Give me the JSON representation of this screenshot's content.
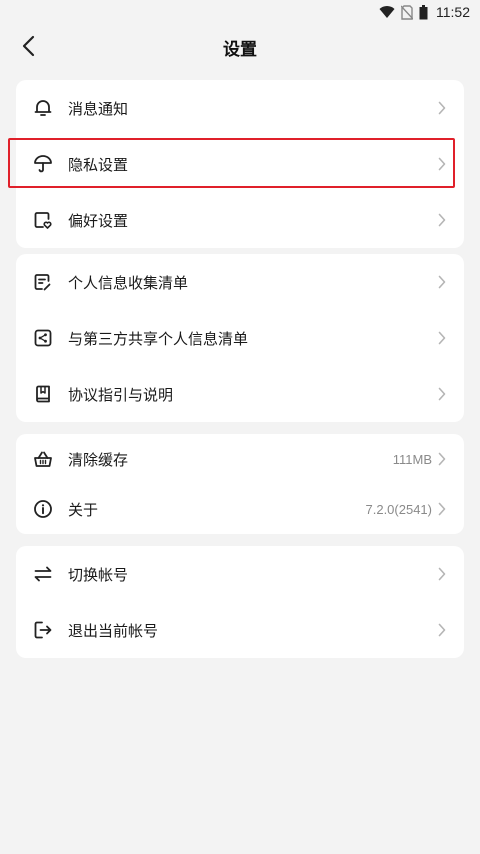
{
  "status_bar": {
    "time": "11:52",
    "icons": [
      "wifi-icon",
      "no-sim-icon",
      "battery-icon"
    ]
  },
  "header": {
    "title": "设置",
    "back_icon": "chevron-left-icon"
  },
  "groups": [
    {
      "items": [
        {
          "label": "消息通知",
          "icon": "bell-icon"
        },
        {
          "label": "隐私设置",
          "icon": "umbrella-icon",
          "highlighted": true
        },
        {
          "label": "偏好设置",
          "icon": "preference-icon"
        }
      ]
    },
    {
      "items": [
        {
          "label": "个人信息收集清单",
          "icon": "document-list-icon"
        },
        {
          "label": "与第三方共享个人信息清单",
          "icon": "share-icon"
        },
        {
          "label": "协议指引与说明",
          "icon": "book-icon"
        }
      ]
    },
    {
      "items": [
        {
          "label": "清除缓存",
          "icon": "basket-icon",
          "value": "111MB"
        },
        {
          "label": "关于",
          "icon": "info-icon",
          "value": "7.2.0(2541)"
        }
      ]
    },
    {
      "items": [
        {
          "label": "切换帐号",
          "icon": "switch-arrows-icon"
        },
        {
          "label": "退出当前帐号",
          "icon": "logout-icon"
        }
      ]
    }
  ],
  "colors": {
    "background": "#f3f3f3",
    "card": "#ffffff",
    "highlight": "#e0202a",
    "secondary_text": "#8a8a8a",
    "chevron": "#b5b5b5"
  }
}
